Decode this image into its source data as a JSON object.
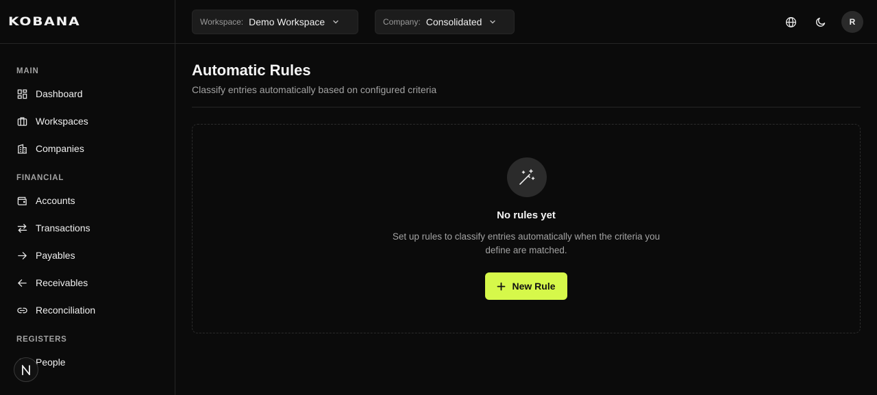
{
  "brand": {
    "logo_text": "KOBANA"
  },
  "topbar": {
    "workspace_key": "Workspace:",
    "workspace_value": "Demo Workspace",
    "company_key": "Company:",
    "company_value": "Consolidated",
    "avatar_initial": "R"
  },
  "sidebar": {
    "sections": [
      {
        "title": "MAIN",
        "items": [
          {
            "label": "Dashboard",
            "icon": "dashboard-icon"
          },
          {
            "label": "Workspaces",
            "icon": "briefcase-icon"
          },
          {
            "label": "Companies",
            "icon": "building-icon"
          }
        ]
      },
      {
        "title": "FINANCIAL",
        "items": [
          {
            "label": "Accounts",
            "icon": "wallet-icon"
          },
          {
            "label": "Transactions",
            "icon": "arrows-swap-icon"
          },
          {
            "label": "Payables",
            "icon": "arrow-right-icon"
          },
          {
            "label": "Receivables",
            "icon": "arrow-left-icon"
          },
          {
            "label": "Reconciliation",
            "icon": "link-icon"
          }
        ]
      },
      {
        "title": "REGISTERS",
        "items": [
          {
            "label": "People",
            "icon": "people-icon"
          }
        ]
      }
    ]
  },
  "page": {
    "title": "Automatic Rules",
    "subtitle": "Classify entries automatically based on configured criteria"
  },
  "empty_state": {
    "icon": "magic-wand-icon",
    "title": "No rules yet",
    "description": "Set up rules to classify entries automatically when the criteria you define are matched.",
    "button_label": "New Rule"
  },
  "colors": {
    "accent": "#d6f84a",
    "background": "#0b0b0b",
    "border": "#262626"
  }
}
